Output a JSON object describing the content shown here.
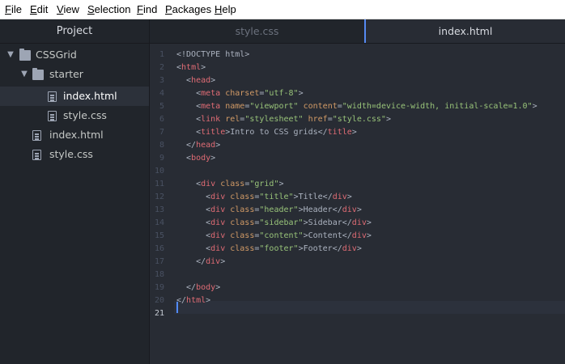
{
  "menu": [
    {
      "first": "F",
      "rest": "ile"
    },
    {
      "first": "E",
      "rest": "dit"
    },
    {
      "first": "V",
      "rest": "iew"
    },
    {
      "first": "S",
      "rest": "election"
    },
    {
      "first": "F",
      "rest": "ind"
    },
    {
      "first": "P",
      "rest": "ackages"
    },
    {
      "first": "H",
      "rest": "elp"
    }
  ],
  "tree": {
    "header": "Project",
    "items": [
      {
        "label": "CSSGrid",
        "type": "folder",
        "expanded": true
      },
      {
        "label": "starter",
        "type": "folder",
        "expanded": true
      },
      {
        "label": "index.html",
        "type": "file",
        "selected": true
      },
      {
        "label": "style.css",
        "type": "file"
      },
      {
        "label": "index.html",
        "type": "file"
      },
      {
        "label": "style.css",
        "type": "file"
      }
    ]
  },
  "tabs": [
    {
      "label": "style.css",
      "active": false
    },
    {
      "label": "index.html",
      "active": true
    }
  ],
  "editor": {
    "current_line": 21,
    "line_numbers": [
      "1",
      "2",
      "3",
      "4",
      "5",
      "6",
      "7",
      "8",
      "9",
      "10",
      "11",
      "12",
      "13",
      "14",
      "15",
      "16",
      "17",
      "18",
      "19",
      "20",
      "21"
    ],
    "lines": [
      [
        [
          "d",
          "<!DOCTYPE html>"
        ]
      ],
      [
        [
          "p",
          "<"
        ],
        [
          "t",
          "html"
        ],
        [
          "p",
          ">"
        ]
      ],
      [
        [
          "p",
          "  <"
        ],
        [
          "t",
          "head"
        ],
        [
          "p",
          ">"
        ]
      ],
      [
        [
          "p",
          "    <"
        ],
        [
          "t",
          "meta "
        ],
        [
          "a",
          "charset"
        ],
        [
          "p",
          "="
        ],
        [
          "s",
          "\"utf-8\""
        ],
        [
          "p",
          ">"
        ]
      ],
      [
        [
          "p",
          "    <"
        ],
        [
          "t",
          "meta "
        ],
        [
          "a",
          "name"
        ],
        [
          "p",
          "="
        ],
        [
          "s",
          "\"viewport\""
        ],
        [
          "p",
          " "
        ],
        [
          "a",
          "content"
        ],
        [
          "p",
          "="
        ],
        [
          "s",
          "\"width=device-width, initial-scale=1.0\""
        ],
        [
          "p",
          ">"
        ]
      ],
      [
        [
          "p",
          "    <"
        ],
        [
          "t",
          "link "
        ],
        [
          "a",
          "rel"
        ],
        [
          "p",
          "="
        ],
        [
          "s",
          "\"stylesheet\""
        ],
        [
          "p",
          " "
        ],
        [
          "a",
          "href"
        ],
        [
          "p",
          "="
        ],
        [
          "s",
          "\"style.css\""
        ],
        [
          "p",
          ">"
        ]
      ],
      [
        [
          "p",
          "    <"
        ],
        [
          "t",
          "title"
        ],
        [
          "p",
          ">Intro to CSS grids</"
        ],
        [
          "t",
          "title"
        ],
        [
          "p",
          ">"
        ]
      ],
      [
        [
          "p",
          "  </"
        ],
        [
          "t",
          "head"
        ],
        [
          "p",
          ">"
        ]
      ],
      [
        [
          "p",
          "  <"
        ],
        [
          "t",
          "body"
        ],
        [
          "p",
          ">"
        ]
      ],
      [
        [
          "p",
          ""
        ]
      ],
      [
        [
          "p",
          "    <"
        ],
        [
          "t",
          "div "
        ],
        [
          "a",
          "class"
        ],
        [
          "p",
          "="
        ],
        [
          "s",
          "\"grid\""
        ],
        [
          "p",
          ">"
        ]
      ],
      [
        [
          "p",
          "      <"
        ],
        [
          "t",
          "div "
        ],
        [
          "a",
          "class"
        ],
        [
          "p",
          "="
        ],
        [
          "s",
          "\"title\""
        ],
        [
          "p",
          ">Title</"
        ],
        [
          "t",
          "div"
        ],
        [
          "p",
          ">"
        ]
      ],
      [
        [
          "p",
          "      <"
        ],
        [
          "t",
          "div "
        ],
        [
          "a",
          "class"
        ],
        [
          "p",
          "="
        ],
        [
          "s",
          "\"header\""
        ],
        [
          "p",
          ">Header</"
        ],
        [
          "t",
          "div"
        ],
        [
          "p",
          ">"
        ]
      ],
      [
        [
          "p",
          "      <"
        ],
        [
          "t",
          "div "
        ],
        [
          "a",
          "class"
        ],
        [
          "p",
          "="
        ],
        [
          "s",
          "\"sidebar\""
        ],
        [
          "p",
          ">Sidebar</"
        ],
        [
          "t",
          "div"
        ],
        [
          "p",
          ">"
        ]
      ],
      [
        [
          "p",
          "      <"
        ],
        [
          "t",
          "div "
        ],
        [
          "a",
          "class"
        ],
        [
          "p",
          "="
        ],
        [
          "s",
          "\"content\""
        ],
        [
          "p",
          ">Content</"
        ],
        [
          "t",
          "div"
        ],
        [
          "p",
          ">"
        ]
      ],
      [
        [
          "p",
          "      <"
        ],
        [
          "t",
          "div "
        ],
        [
          "a",
          "class"
        ],
        [
          "p",
          "="
        ],
        [
          "s",
          "\"footer\""
        ],
        [
          "p",
          ">Footer</"
        ],
        [
          "t",
          "div"
        ],
        [
          "p",
          ">"
        ]
      ],
      [
        [
          "p",
          "    </"
        ],
        [
          "t",
          "div"
        ],
        [
          "p",
          ">"
        ]
      ],
      [
        [
          "p",
          ""
        ]
      ],
      [
        [
          "p",
          "  </"
        ],
        [
          "t",
          "body"
        ],
        [
          "p",
          ">"
        ]
      ],
      [
        [
          "p",
          "</"
        ],
        [
          "t",
          "html"
        ],
        [
          "p",
          ">"
        ]
      ],
      [
        [
          "p",
          ""
        ]
      ]
    ]
  },
  "colors": {
    "tag": "#e06c75",
    "attr": "#d19a66",
    "string": "#98c379",
    "cursor": "#528bff"
  }
}
